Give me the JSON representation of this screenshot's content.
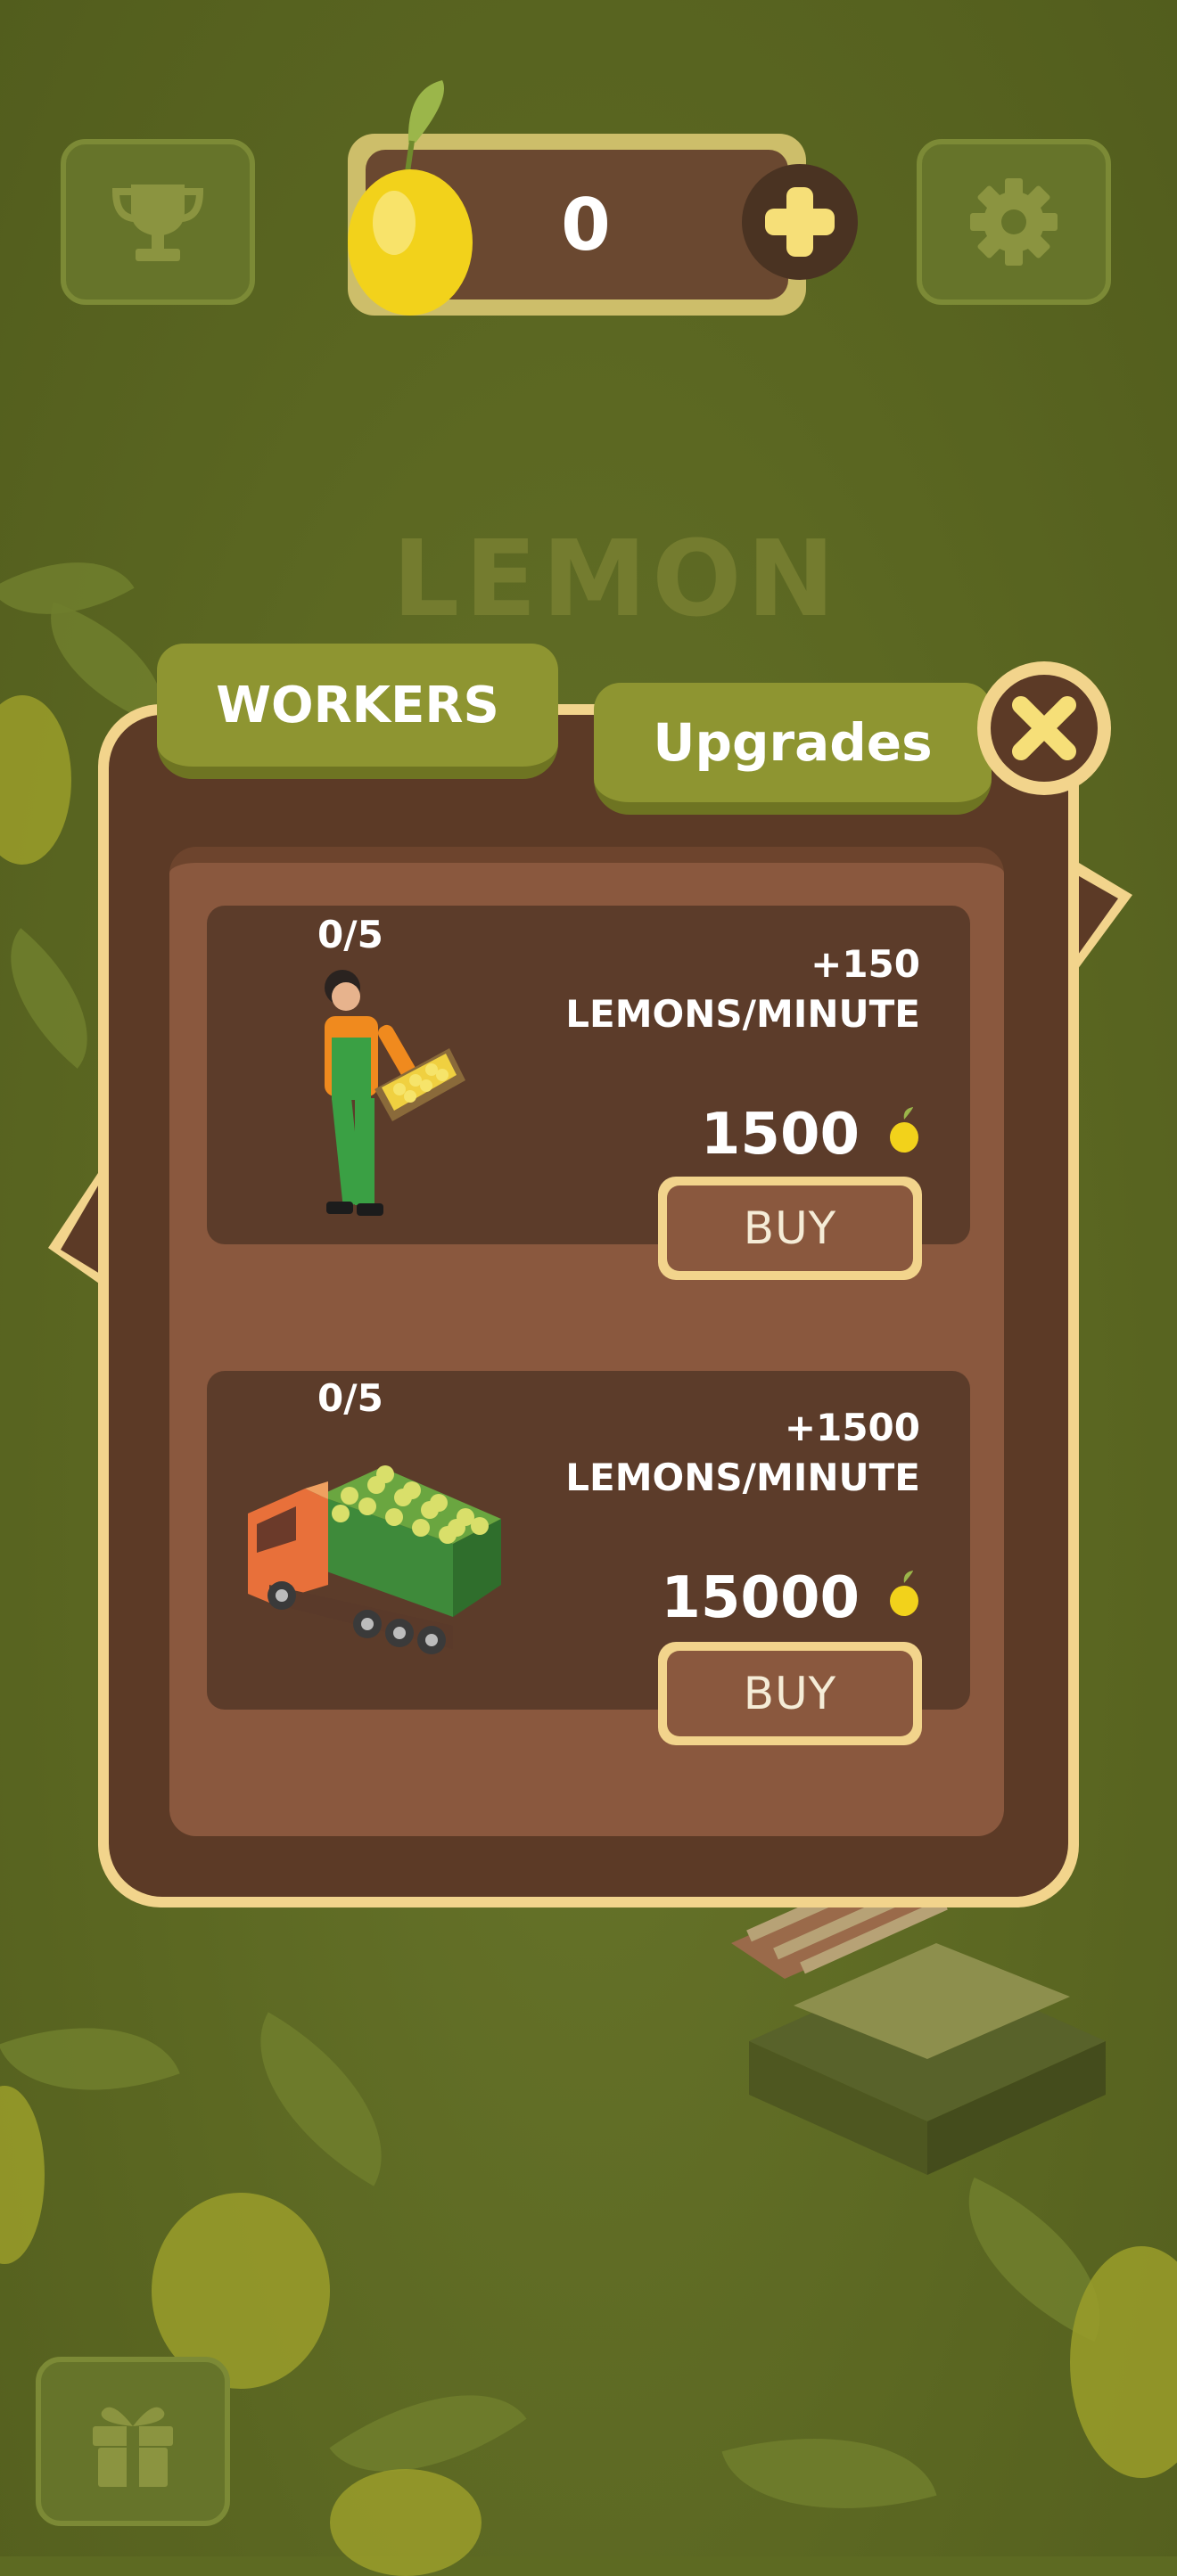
{
  "top_bar": {
    "lemon_count": "0"
  },
  "title_logo": "LEMON",
  "panel": {
    "tabs": [
      {
        "label": "WORKERS"
      },
      {
        "label": "Upgrades"
      }
    ],
    "items": [
      {
        "count": "0/5",
        "rate_amount": "+150",
        "rate_unit": "LEMONS/MINUTE",
        "price": "1500",
        "buy_label": "BUY",
        "icon": "farm-worker-icon"
      },
      {
        "count": "0/5",
        "rate_amount": "+1500",
        "rate_unit": "LEMONS/MINUTE",
        "price": "15000",
        "buy_label": "BUY",
        "icon": "lemon-truck-icon"
      }
    ]
  },
  "colors": {
    "background": "#5d6a22",
    "panel_border": "#f2d48c",
    "panel_dark": "#5c3a26",
    "tab_green": "#8e9531",
    "button_brown": "#8a583e"
  }
}
